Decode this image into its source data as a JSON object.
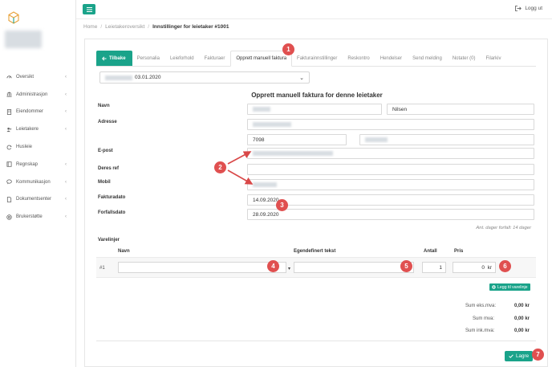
{
  "topbar": {
    "logout_label": "Logg ut"
  },
  "sidebar": {
    "items": [
      {
        "label": "Oversikt",
        "icon": "gauge-icon"
      },
      {
        "label": "Administrasjon",
        "icon": "bank-icon"
      },
      {
        "label": "Eiendommer",
        "icon": "building-icon"
      },
      {
        "label": "Leietakere",
        "icon": "users-icon"
      },
      {
        "label": "Husleie",
        "icon": "refresh-icon"
      },
      {
        "label": "Regnskap",
        "icon": "book-icon"
      },
      {
        "label": "Kommunikasjon",
        "icon": "chat-icon"
      },
      {
        "label": "Dokumentsenter",
        "icon": "document-icon"
      },
      {
        "label": "Brukerstøtte",
        "icon": "lifebuoy-icon"
      }
    ]
  },
  "breadcrumb": {
    "home": "Home",
    "overview": "Leietakeroversikt",
    "current": "Innstillinger for leietaker #1001"
  },
  "tabs": {
    "back": "Tilbake",
    "items": [
      "Personalia",
      "Leieforhold",
      "Fakturaer",
      "Opprett manuell faktura",
      "Fakturainnstillinger",
      "Reskontro",
      "Hendelser",
      "Send melding",
      "Notater (0)",
      "Filarkiv"
    ]
  },
  "contract_select": {
    "value": "03.01.2020"
  },
  "form": {
    "title": "Opprett manuell faktura for denne leietaker",
    "labels": {
      "name": "Navn",
      "address": "Adresse",
      "email": "E-post",
      "ref": "Deres ref",
      "mobile": "Mobil",
      "invoice_date": "Fakturadato",
      "due_date": "Forfallsdato"
    },
    "last_name": "Nilsen",
    "zip": "7098",
    "invoice_date": "14.09.2020",
    "due_date": "28.09.2020",
    "due_note": "Ant. dager forfall: 14 dager"
  },
  "lines": {
    "section": "Varelinjer",
    "col_name": "Navn",
    "col_text": "Egendefinert tekst",
    "col_qty": "Antall",
    "col_price": "Pris",
    "row_num": "#1",
    "qty": "1",
    "price": "0",
    "price_unit": "kr",
    "add_label": "Legg til varelinje"
  },
  "totals": {
    "ex_vat_label": "Sum eks.mva:",
    "ex_vat": "0,00 kr",
    "vat_label": "Sum mva:",
    "vat": "0,00 kr",
    "inc_vat_label": "Sum ink.mva:",
    "inc_vat": "0,00 kr"
  },
  "save_label": "Lagre",
  "callouts": [
    "1",
    "2",
    "3",
    "4",
    "5",
    "6",
    "7"
  ],
  "accent": "#1aa38a",
  "callout_color": "#e05050"
}
